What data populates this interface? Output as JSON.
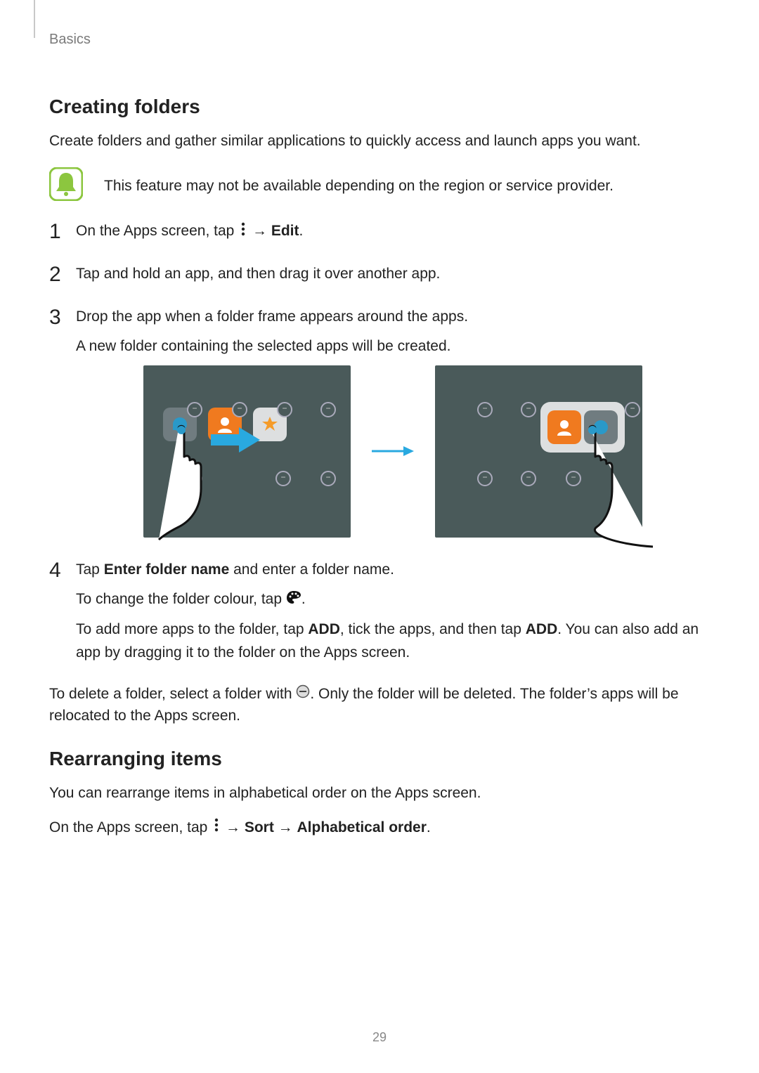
{
  "breadcrumb": "Basics",
  "section1": {
    "title": "Creating folders",
    "intro": "Create folders and gather similar applications to quickly access and launch apps you want.",
    "note": "This feature may not be available depending on the region or service provider.",
    "step1_a": "On the Apps screen, tap ",
    "step1_b": " → ",
    "step1_c": "Edit",
    "step1_d": ".",
    "step2": "Tap and hold an app, and then drag it over another app.",
    "step3_a": "Drop the app when a folder frame appears around the apps.",
    "step3_b": "A new folder containing the selected apps will be created.",
    "step4_a": "Tap ",
    "step4_b": "Enter folder name",
    "step4_c": " and enter a folder name.",
    "step4_colour_a": "To change the folder colour, tap ",
    "step4_colour_b": ".",
    "step4_add_a": "To add more apps to the folder, tap ",
    "step4_add_b": "ADD",
    "step4_add_c": ", tick the apps, and then tap ",
    "step4_add_d": "ADD",
    "step4_add_e": ". You can also add an app by dragging it to the folder on the Apps screen.",
    "delete_a": "To delete a folder, select a folder with ",
    "delete_b": ". Only the folder will be deleted. The folder’s apps will be relocated to the Apps screen."
  },
  "section2": {
    "title": "Rearranging items",
    "p1": "You can rearrange items in alphabetical order on the Apps screen.",
    "p2_a": "On the Apps screen, tap ",
    "p2_b": " → ",
    "p2_c": "Sort",
    "p2_d": " → ",
    "p2_e": "Alphabetical order",
    "p2_f": "."
  },
  "pagenum": "29"
}
